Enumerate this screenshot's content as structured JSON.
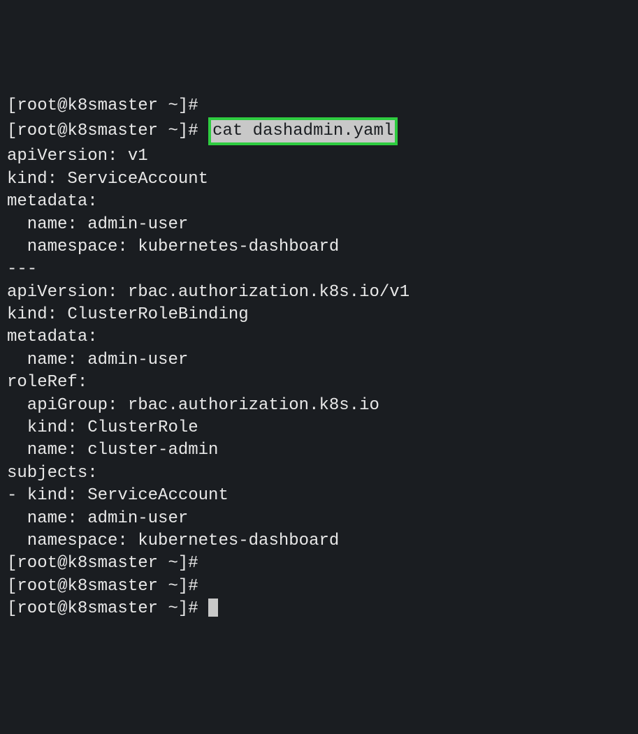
{
  "terminal": {
    "prompt": "[root@k8smaster ~]#",
    "command_highlighted": "cat dashadmin.yaml",
    "output_lines": [
      "apiVersion: v1",
      "kind: ServiceAccount",
      "metadata:",
      "  name: admin-user",
      "  namespace: kubernetes-dashboard",
      "---",
      "apiVersion: rbac.authorization.k8s.io/v1",
      "kind: ClusterRoleBinding",
      "metadata:",
      "  name: admin-user",
      "roleRef:",
      "  apiGroup: rbac.authorization.k8s.io",
      "  kind: ClusterRole",
      "  name: cluster-admin",
      "subjects:",
      "- kind: ServiceAccount",
      "  name: admin-user",
      "  namespace: kubernetes-dashboard"
    ]
  }
}
